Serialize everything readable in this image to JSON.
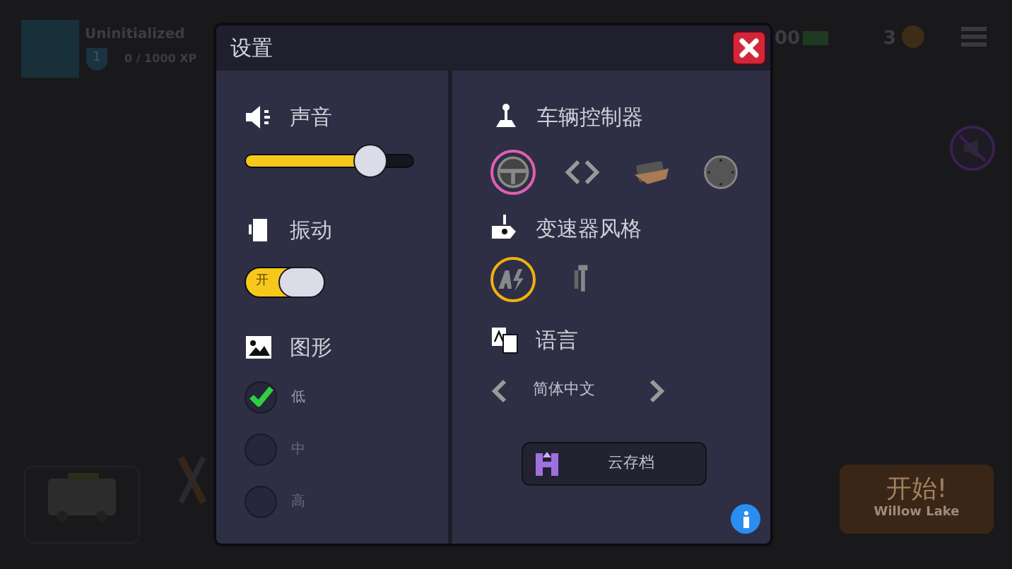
{
  "background": {
    "player": {
      "name": "Uninitialized",
      "level": "1",
      "xp": "0 / 1000 XP"
    },
    "cash": "00",
    "coins": "3",
    "start_button": {
      "label": "开始!",
      "location": "Willow Lake"
    }
  },
  "dialog": {
    "title": "设置",
    "sound": {
      "label": "声音",
      "level": 0.8
    },
    "vibration": {
      "label": "振动",
      "on": true,
      "switch_label": "开"
    },
    "graphics": {
      "label": "图形",
      "options": [
        {
          "label": "低",
          "selected": true
        },
        {
          "label": "中",
          "selected": false
        },
        {
          "label": "高",
          "selected": false
        }
      ]
    },
    "controls": {
      "label": "车辆控制器",
      "options": [
        {
          "kind": "wheel",
          "selected": true
        },
        {
          "kind": "arrows",
          "selected": false
        },
        {
          "kind": "tilt",
          "selected": false
        },
        {
          "kind": "joystick",
          "selected": false
        }
      ]
    },
    "transmission": {
      "label": "变速器风格",
      "options": [
        {
          "kind": "automatic",
          "selected": true
        },
        {
          "kind": "manual",
          "selected": false
        }
      ]
    },
    "language": {
      "label": "语言",
      "value": "简体中文"
    },
    "cloud_save": "云存档"
  }
}
